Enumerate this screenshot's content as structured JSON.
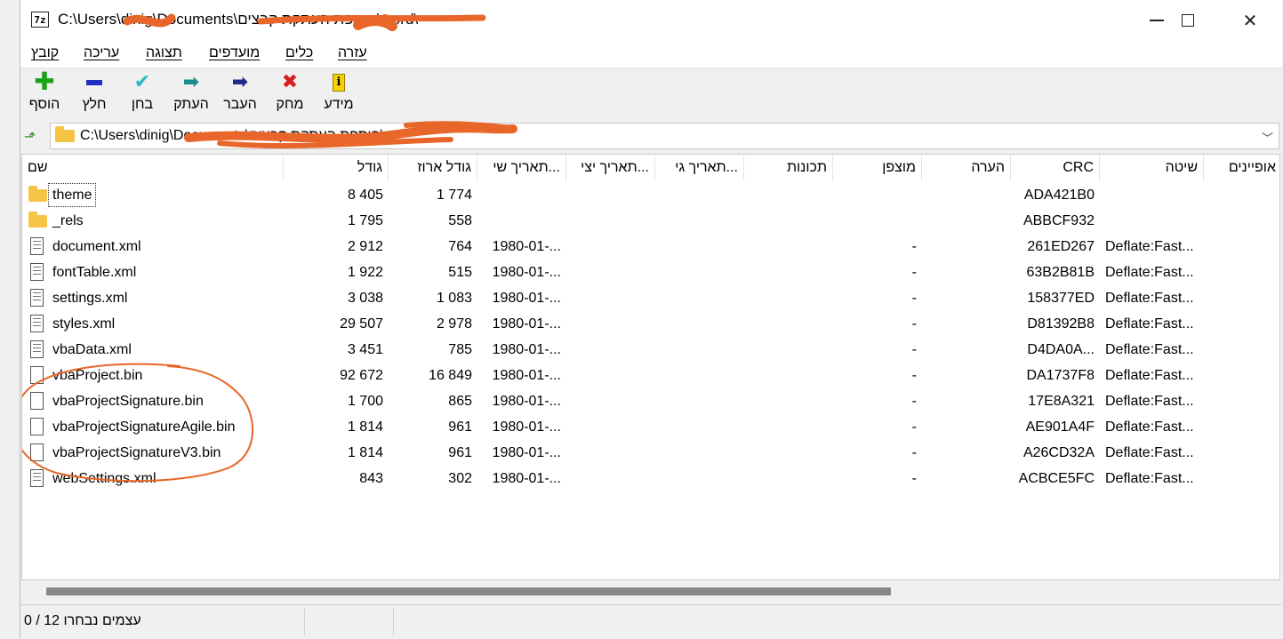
{
  "window": {
    "title": "C:\\Users\\dinig\\Documents\\הוספת העתקת קבצים\\word\\",
    "app_icon_text": "7z"
  },
  "menu": [
    {
      "label": "קובץ"
    },
    {
      "label": "עריכה"
    },
    {
      "label": "תצוגה"
    },
    {
      "label": "מועדפים"
    },
    {
      "label": "כלים"
    },
    {
      "label": "עזרה"
    }
  ],
  "toolbar": [
    {
      "label": "הוסף",
      "icon": "plus-icon",
      "color": "#1aa31a"
    },
    {
      "label": "חלץ",
      "icon": "minus-icon",
      "color": "#1f2fc0"
    },
    {
      "label": "בחן",
      "icon": "check-icon",
      "color": "#27b8c8"
    },
    {
      "label": "העתק",
      "icon": "copy-arrow-icon",
      "color": "#1a8c8c"
    },
    {
      "label": "העבר",
      "icon": "move-arrow-icon",
      "color": "#1f2a8c"
    },
    {
      "label": "מחק",
      "icon": "delete-icon",
      "color": "#d81e1e"
    },
    {
      "label": "מידע",
      "icon": "info-icon",
      "color": "#c9a100"
    }
  ],
  "address": {
    "value": "C:\\Users\\dinig\\Documents\\הוספת העתקת קבצים\\"
  },
  "columns": [
    "שם",
    "גודל",
    "גודל ארוז",
    "תאריך שי...",
    "תאריך יצי...",
    "תאריך גי...",
    "תכונות",
    "מוצפן",
    "הערה",
    "CRC",
    "שיטה",
    "אופיינים"
  ],
  "files": [
    {
      "name": "theme",
      "type": "folder",
      "size": "8 405",
      "packed": "1 774",
      "modified": "",
      "encrypted": "",
      "crc": "ADA421B0",
      "method": ""
    },
    {
      "name": "_rels",
      "type": "folder",
      "size": "1 795",
      "packed": "558",
      "modified": "",
      "encrypted": "",
      "crc": "ABBCF932",
      "method": ""
    },
    {
      "name": "document.xml",
      "type": "xml",
      "size": "2 912",
      "packed": "764",
      "modified": "1980-01-...",
      "encrypted": "-",
      "crc": "261ED267",
      "method": "Deflate:Fast..."
    },
    {
      "name": "fontTable.xml",
      "type": "xml",
      "size": "1 922",
      "packed": "515",
      "modified": "1980-01-...",
      "encrypted": "-",
      "crc": "63B2B81B",
      "method": "Deflate:Fast..."
    },
    {
      "name": "settings.xml",
      "type": "xml",
      "size": "3 038",
      "packed": "1 083",
      "modified": "1980-01-...",
      "encrypted": "-",
      "crc": "158377ED",
      "method": "Deflate:Fast..."
    },
    {
      "name": "styles.xml",
      "type": "xml",
      "size": "29 507",
      "packed": "2 978",
      "modified": "1980-01-...",
      "encrypted": "-",
      "crc": "D81392B8",
      "method": "Deflate:Fast..."
    },
    {
      "name": "vbaData.xml",
      "type": "xml",
      "size": "3 451",
      "packed": "785",
      "modified": "1980-01-...",
      "encrypted": "-",
      "crc": "D4DA0A...",
      "method": "Deflate:Fast..."
    },
    {
      "name": "vbaProject.bin",
      "type": "bin",
      "size": "92 672",
      "packed": "16 849",
      "modified": "1980-01-...",
      "encrypted": "-",
      "crc": "DA1737F8",
      "method": "Deflate:Fast..."
    },
    {
      "name": "vbaProjectSignature.bin",
      "type": "bin",
      "size": "1 700",
      "packed": "865",
      "modified": "1980-01-...",
      "encrypted": "-",
      "crc": "17E8A321",
      "method": "Deflate:Fast..."
    },
    {
      "name": "vbaProjectSignatureAgile.bin",
      "type": "bin",
      "size": "1 814",
      "packed": "961",
      "modified": "1980-01-...",
      "encrypted": "-",
      "crc": "AE901A4F",
      "method": "Deflate:Fast..."
    },
    {
      "name": "vbaProjectSignatureV3.bin",
      "type": "bin",
      "size": "1 814",
      "packed": "961",
      "modified": "1980-01-...",
      "encrypted": "-",
      "crc": "A26CD32A",
      "method": "Deflate:Fast..."
    },
    {
      "name": "webSettings.xml",
      "type": "xml",
      "size": "843",
      "packed": "302",
      "modified": "1980-01-...",
      "encrypted": "-",
      "crc": "ACBCE5FC",
      "method": "Deflate:Fast..."
    }
  ],
  "status": {
    "text": "0 / 12 עצמים נבחרו"
  },
  "annotation_color": "#e8662a"
}
